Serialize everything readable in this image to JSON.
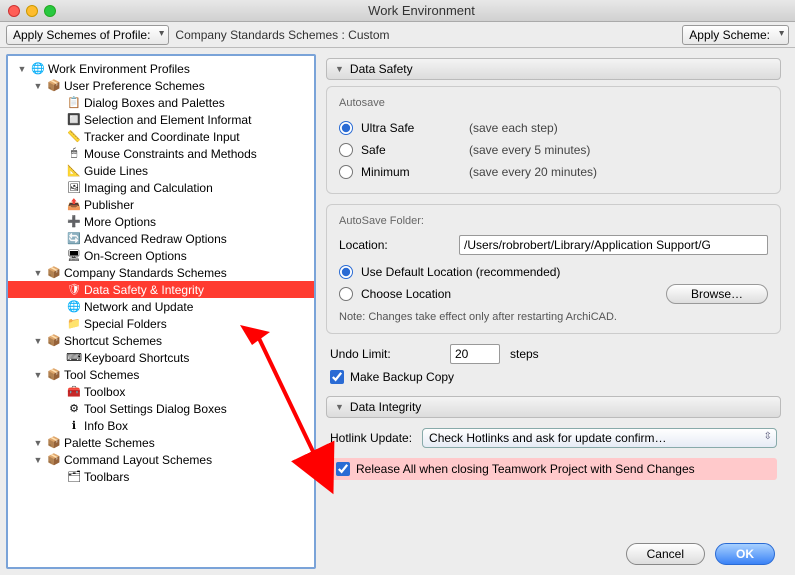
{
  "window": {
    "title": "Work Environment"
  },
  "toolbar": {
    "apply_schemes_label": "Apply Schemes of Profile:",
    "breadcrumb": "Company Standards Schemes : Custom",
    "apply_scheme_label": "Apply Scheme:"
  },
  "tree": {
    "root": "Work Environment Profiles",
    "groups": [
      {
        "label": "User Preference Schemes",
        "items": [
          "Dialog Boxes and Palettes",
          "Selection and Element Informat",
          "Tracker and Coordinate Input",
          "Mouse Constraints and Methods",
          "Guide Lines",
          "Imaging and Calculation",
          "Publisher",
          "More Options",
          "Advanced Redraw Options",
          "On-Screen Options"
        ]
      },
      {
        "label": "Company Standards Schemes",
        "items": [
          "Data Safety & Integrity",
          "Network and Update",
          "Special Folders"
        ],
        "selected_index": 0
      },
      {
        "label": "Shortcut Schemes",
        "items": [
          "Keyboard Shortcuts"
        ]
      },
      {
        "label": "Tool Schemes",
        "items": [
          "Toolbox",
          "Tool Settings Dialog Boxes",
          "Info Box"
        ]
      },
      {
        "label": "Palette Schemes",
        "items": []
      },
      {
        "label": "Command Layout Schemes",
        "items": [
          "Toolbars"
        ]
      }
    ]
  },
  "tree_icons": [
    "📋",
    "🔲",
    "📏",
    "🖱",
    "📐",
    "🖼",
    "📤",
    "➕",
    "🔄",
    "🖥",
    "🛡",
    "🌐",
    "📁",
    "⌨",
    "🧰",
    "⚙",
    "ℹ",
    "🗂",
    "📊"
  ],
  "data_safety": {
    "header": "Data Safety",
    "autosave": {
      "title": "Autosave",
      "options": [
        {
          "label": "Ultra Safe",
          "hint": "(save each step)",
          "checked": true
        },
        {
          "label": "Safe",
          "hint": "(save every 5 minutes)",
          "checked": false
        },
        {
          "label": "Minimum",
          "hint": "(save every 20 minutes)",
          "checked": false
        }
      ]
    },
    "folder": {
      "title": "AutoSave Folder:",
      "location_label": "Location:",
      "location_value": "/Users/robrobert/Library/Application Support/G",
      "use_default_label": "Use Default Location (recommended)",
      "choose_label": "Choose Location",
      "browse_label": "Browse…",
      "note": "Note: Changes take effect only after restarting ArchiCAD."
    },
    "undo": {
      "label": "Undo Limit:",
      "value": "20",
      "unit": "steps"
    },
    "backup_label": "Make Backup Copy"
  },
  "data_integrity": {
    "header": "Data Integrity",
    "hotlink_label": "Hotlink Update:",
    "hotlink_value": "Check Hotlinks and ask for update confirm…",
    "release_label": "Release All when closing Teamwork Project with Send Changes"
  },
  "buttons": {
    "cancel": "Cancel",
    "ok": "OK"
  }
}
